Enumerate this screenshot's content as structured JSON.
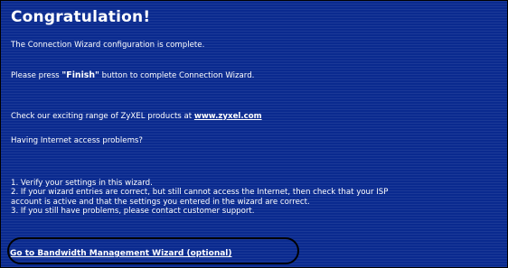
{
  "page": {
    "title": "Congratulation!",
    "complete_message": "The Connection Wizard configuration is complete.",
    "finish_instruction": {
      "before": "Please press ",
      "button_word": "\"Finish\"",
      "after": " button to complete Connection Wizard."
    },
    "products": {
      "text": "Check our exciting range of ZyXEL products at ",
      "link": "www.zyxel.com"
    },
    "problems_heading": "Having Internet access problems?",
    "steps": [
      "1. Verify your settings in this wizard.",
      "2. If your wizard entries are correct, but still cannot access the Internet, then check that your ISP",
      "account is active and that the settings you entered in the wizard are correct.",
      "3. If you still have problems, please contact customer support."
    ],
    "bandwidth_link": "Go to Bandwidth Management Wizard (optional)"
  },
  "colors": {
    "background": "#0a2a8f",
    "text": "#ffffff",
    "highlight": "#000000"
  }
}
